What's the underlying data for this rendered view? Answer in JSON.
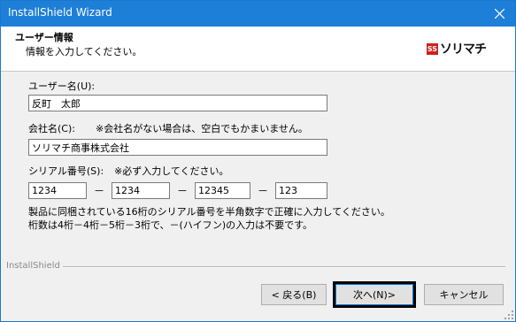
{
  "window": {
    "title": "InstallShield Wizard"
  },
  "header": {
    "title": "ユーザー情報",
    "subtitle": "情報を入力してください。",
    "logo": {
      "mark": "SS",
      "brand": "ソリマチ"
    }
  },
  "form": {
    "user_label": "ユーザー名(U):",
    "user_value": "反町　太郎",
    "company_label": "会社名(C):",
    "company_note": "※会社名がない場合は、空白でもかまいません。",
    "company_value": "ソリマチ商事株式会社",
    "serial_label": "シリアル番号(S):",
    "serial_note": "※必ず入力してください。",
    "serial": [
      "1234",
      "1234",
      "12345",
      "123"
    ],
    "dash": "－",
    "help1": "製品に同梱されている16桁のシリアル番号を半角数字で正確に入力してください。",
    "help2": "桁数は4桁－4桁－5桁－3桁で、－(ハイフン)の入力は不要です。"
  },
  "footer": {
    "brand": "InstallShield"
  },
  "buttons": {
    "back": "< 戻る(B)",
    "next": "次へ(N)>",
    "cancel": "キャンセル"
  }
}
